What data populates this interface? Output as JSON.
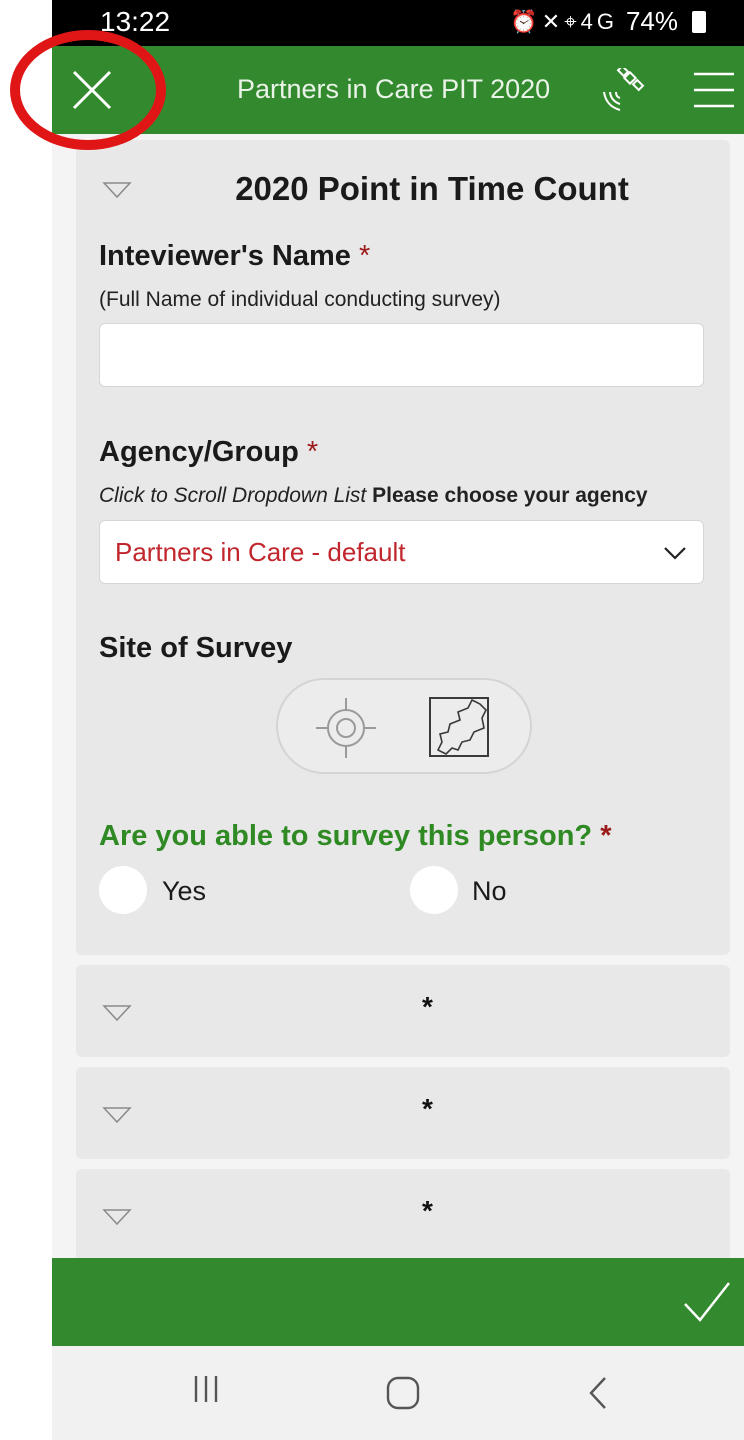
{
  "status_bar": {
    "time": "13:22",
    "icons": "⏰✕⌖4G",
    "battery": "74%"
  },
  "app_bar": {
    "title": "Partners in Care PIT 2020"
  },
  "section": {
    "title": "2020 Point in Time Count"
  },
  "fields": {
    "interviewer": {
      "label": "Inteviewer's Name",
      "required_mark": "*",
      "hint": "(Full Name of individual conducting survey)",
      "value": ""
    },
    "agency": {
      "label": "Agency/Group",
      "required_mark": "*",
      "hint_italic": "Click to Scroll Dropdown List",
      "hint_bold": "Please choose your agency",
      "selected": "Partners in Care - default"
    },
    "site": {
      "label": "Site of Survey"
    },
    "able": {
      "label": "Are you able to survey this person?",
      "required_mark": "*",
      "options": [
        "Yes",
        "No"
      ]
    }
  },
  "collapsed_sections": [
    {
      "mark": "*"
    },
    {
      "mark": "*"
    },
    {
      "mark": "*"
    }
  ],
  "colors": {
    "green": "#338a2e",
    "required": "#9b1a1a",
    "selected_text": "#c0262c",
    "annotation": "#e01515"
  }
}
